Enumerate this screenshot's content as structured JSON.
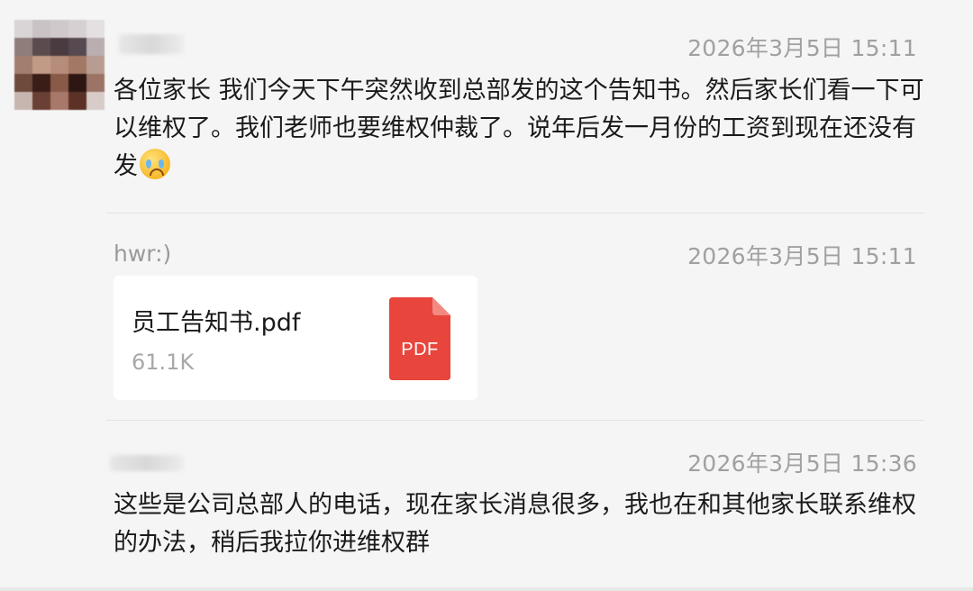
{
  "messages": [
    {
      "sender": "",
      "time": "2026年3月5日 15:11",
      "text": "各位家长 我们今天下午突然收到总部发的这个告知书。然后家长们看一下可以维权了。我们老师也要维权仲裁了。说年后发一月份的工资到现在还没有发",
      "emoji": "crying-face"
    },
    {
      "sender": "hwr:)",
      "time": "2026年3月5日 15:11",
      "file": {
        "name": "员工告知书.pdf",
        "size": "61.1K",
        "icon_label": "PDF",
        "icon_color": "#e8453c"
      }
    },
    {
      "sender": "",
      "time": "2026年3月5日 15:36",
      "text": "这些是公司总部人的电话，现在家长消息很多，我也在和其他家长联系维权的办法，稍后我拉你进维权群"
    }
  ]
}
